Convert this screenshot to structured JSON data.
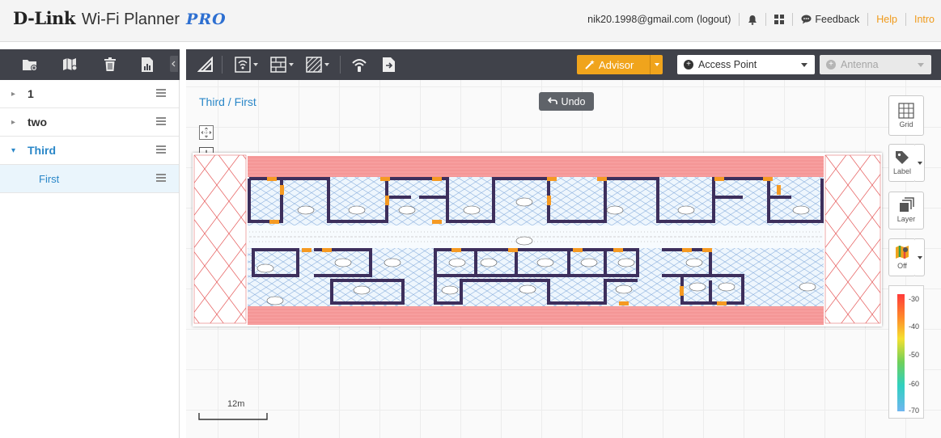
{
  "header": {
    "brand": "D-Link",
    "app_name": "Wi-Fi Planner",
    "edition": "PRO",
    "user_email": "nik20.1998@gmail.com",
    "logout_label": "(logout)",
    "feedback_label": "Feedback",
    "help_label": "Help",
    "intro_label": "Intro",
    "icons": [
      "bell-icon",
      "grid-apps-icon",
      "speech-bubble-icon"
    ]
  },
  "left_toolbar": {
    "icons": [
      "add-folder-icon",
      "map-icon",
      "trash-icon",
      "report-icon"
    ]
  },
  "floors": [
    {
      "label": "1",
      "expanded": false
    },
    {
      "label": "two",
      "expanded": false
    },
    {
      "label": "Third",
      "expanded": true,
      "children": [
        {
          "label": "First",
          "selected": true
        }
      ]
    }
  ],
  "main_toolbar": {
    "tools": [
      "wall-tool-icon",
      "wifi-signal-dropdown-icon",
      "building-element-dropdown-icon",
      "hatch-area-dropdown-icon",
      "wifi-device-icon",
      "export-file-icon"
    ],
    "advisor_label": "Advisor",
    "device_select": "Access Point",
    "antenna_select": "Antenna"
  },
  "canvas": {
    "breadcrumb": "Third / First",
    "undo_label": "Undo",
    "scale_label": "12m",
    "zoom_in": "+",
    "zoom_out": "−"
  },
  "right_controls": {
    "grid_label": "Grid",
    "label_label": "Label",
    "layer_label": "Layer",
    "heatmap_label": "Off"
  },
  "legend": {
    "ticks": [
      "-30",
      "-40",
      "-50",
      "-60",
      "-70"
    ]
  },
  "colors": {
    "accent_orange": "#f0a41c",
    "toolbar_dark": "#40424a",
    "link_blue": "#2a87c8",
    "wall": "#3d2f5c",
    "door": "#f59a23"
  }
}
